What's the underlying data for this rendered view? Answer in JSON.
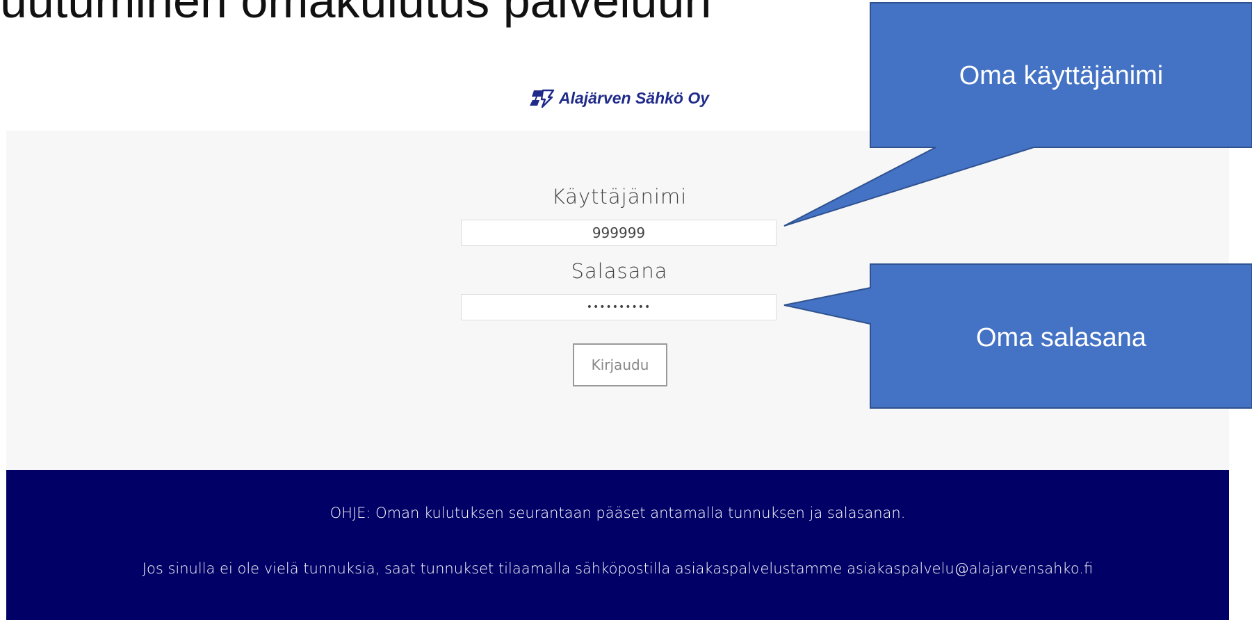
{
  "slide": {
    "title": "uutuminen omakulutus palveluun"
  },
  "brand": {
    "name": "Alajärven Sähkö Oy",
    "color": "#1f2a8a"
  },
  "login": {
    "username_label": "Käyttäjänimi",
    "username_value": "999999",
    "password_label": "Salasana",
    "password_value": "••••••••••",
    "login_button": "Kirjaudu",
    "panel_color": "#f7f7f7"
  },
  "footer": {
    "instruction": "OHJE: Oman kulutuksen seurantaan pääset antamalla tunnuksen ja salasanan.",
    "no_account": "Jos sinulla ei ole vielä tunnuksia, saat tunnukset tilaamalla sähköpostilla asiakaspalvelustamme asiakaspalvelu@alajarvensahko.fi",
    "background": "#000066"
  },
  "callouts": {
    "username": "Oma käyttäjänimi",
    "password": "Oma salasana",
    "color": "#4472c4",
    "border_color": "#2f528f"
  }
}
